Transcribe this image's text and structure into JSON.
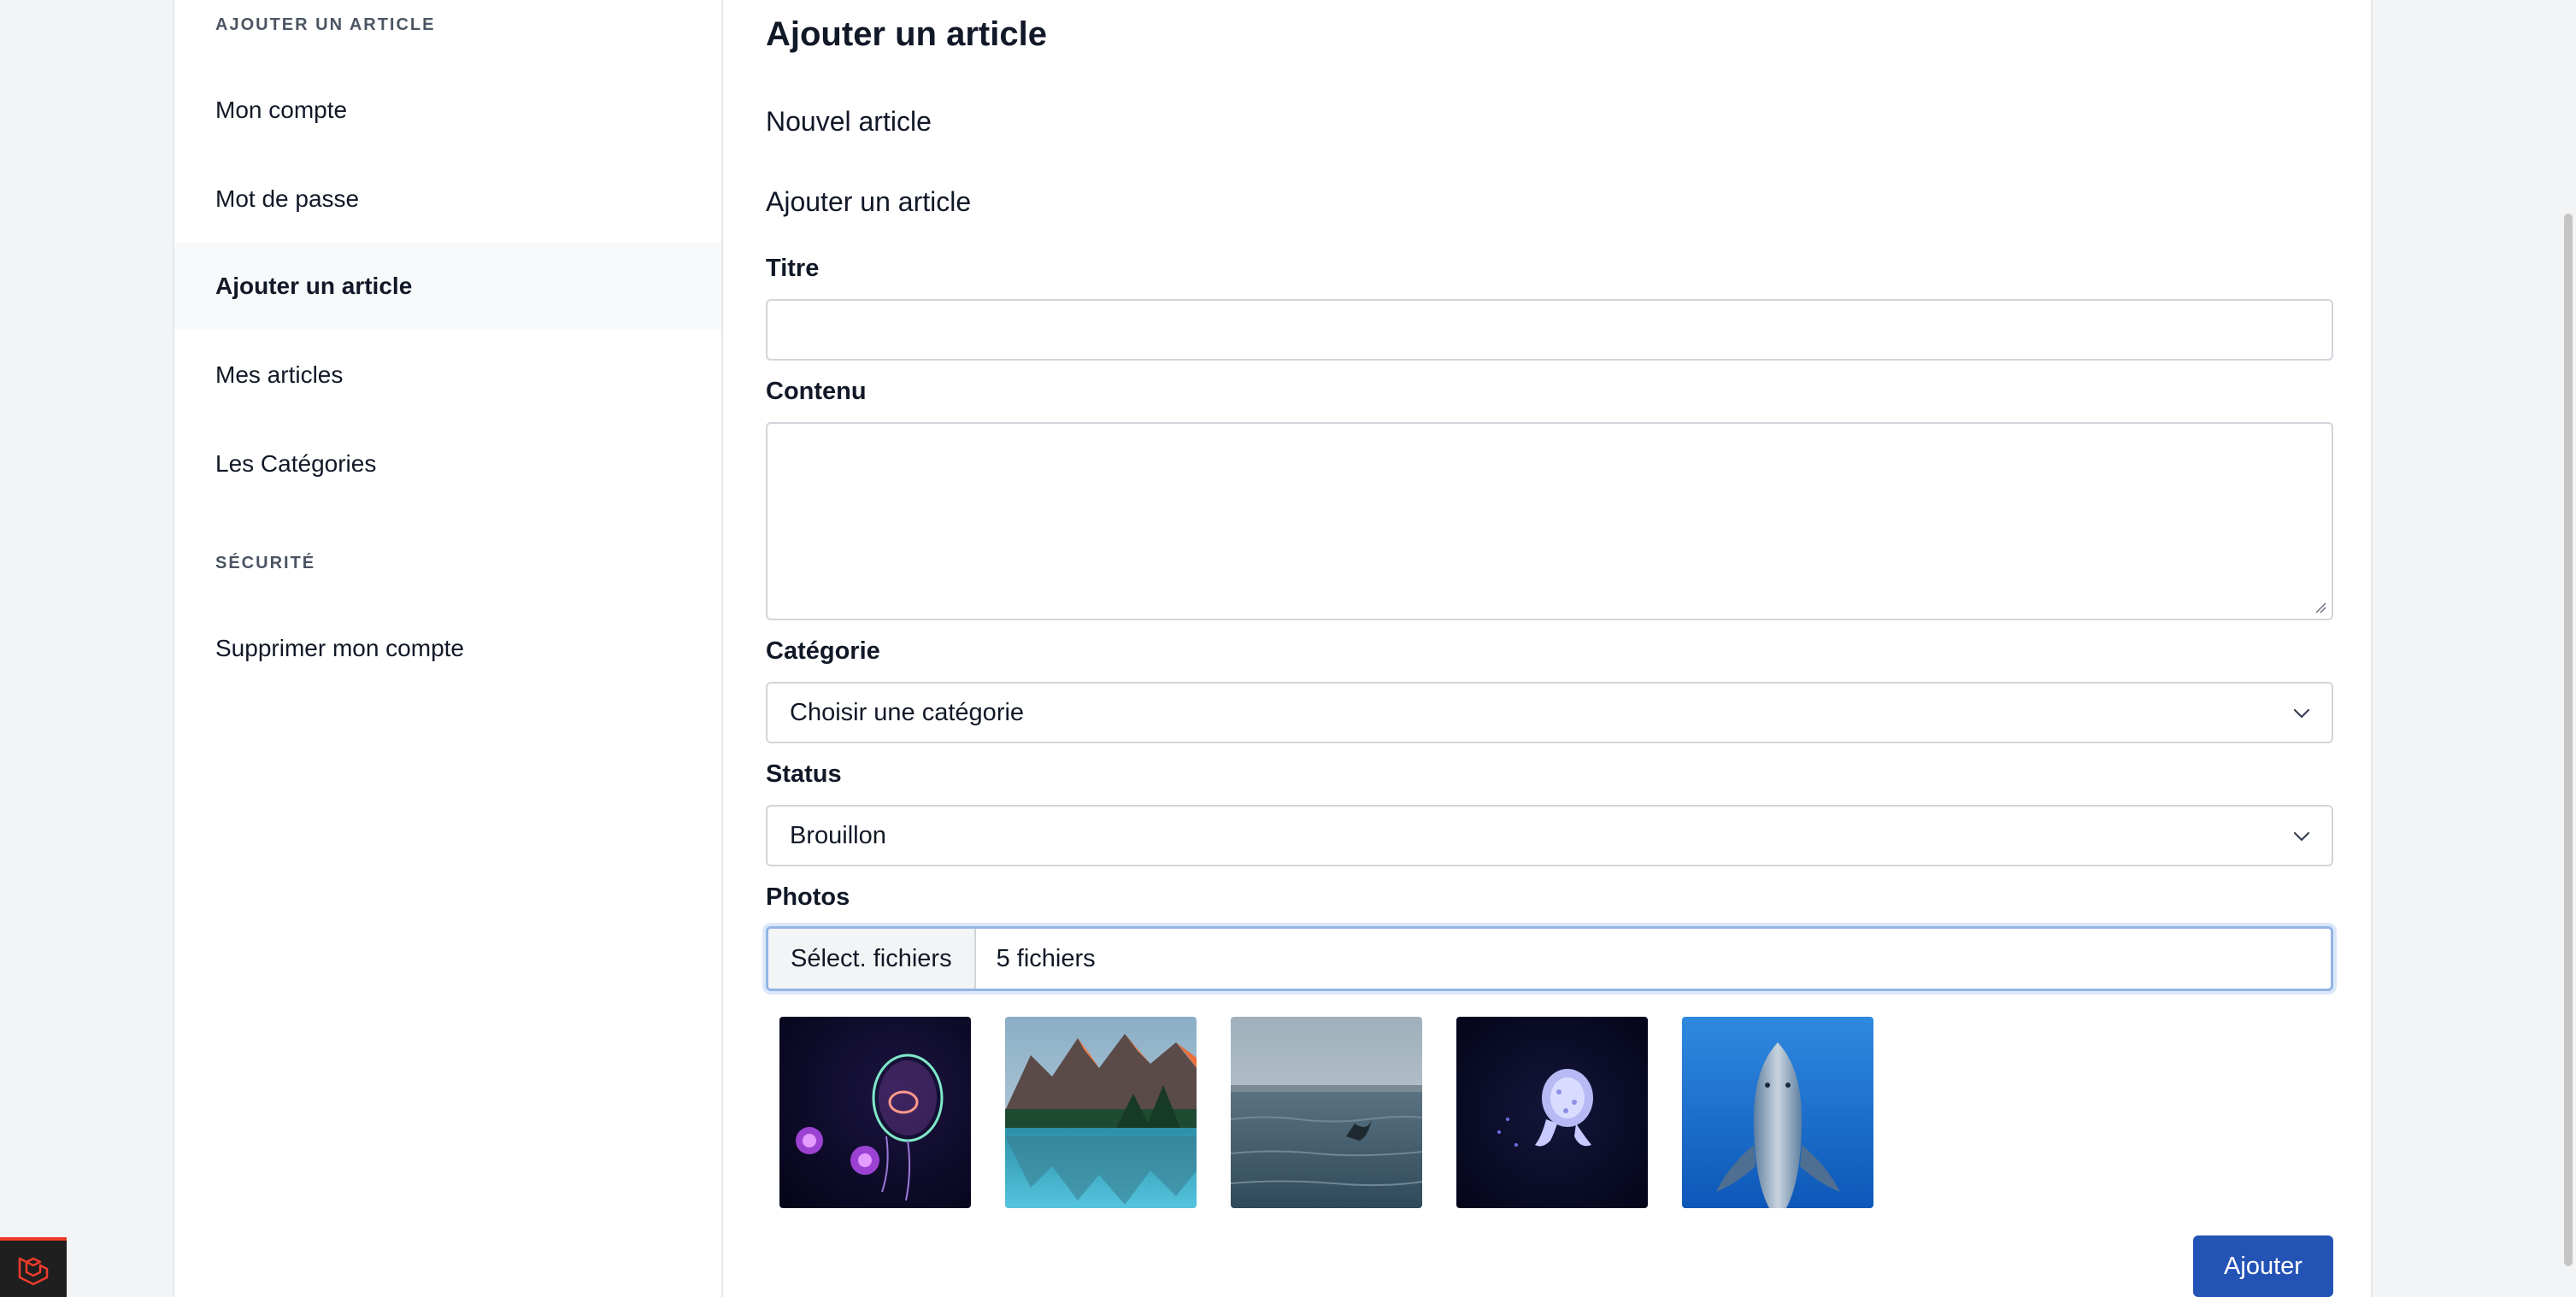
{
  "sidebar": {
    "section_article": "AJOUTER UN ARTICLE",
    "section_security": "SÉCURITÉ",
    "items": [
      {
        "label": "Mon compte"
      },
      {
        "label": "Mot de passe"
      },
      {
        "label": "Ajouter un article"
      },
      {
        "label": "Mes articles"
      },
      {
        "label": "Les Catégories"
      }
    ],
    "security_items": [
      {
        "label": "Supprimer mon compte"
      }
    ]
  },
  "main": {
    "page_title": "Ajouter un article",
    "card_header": "Nouvel article",
    "form_title": "Ajouter un article",
    "fields": {
      "titre_label": "Titre",
      "titre_value": "",
      "contenu_label": "Contenu",
      "contenu_value": "",
      "categorie_label": "Catégorie",
      "categorie_value": "Choisir une catégorie",
      "status_label": "Status",
      "status_value": "Brouillon",
      "photos_label": "Photos",
      "photos_button": "Sélect. fichiers",
      "photos_count": "5 fichiers"
    },
    "thumbnails": [
      {
        "name": "jellyfish-pink"
      },
      {
        "name": "mountain-lake"
      },
      {
        "name": "whale-tail-ocean"
      },
      {
        "name": "jellyfish-white"
      },
      {
        "name": "dolphin"
      }
    ],
    "submit_label": "Ajouter"
  },
  "colors": {
    "accent": "#2453b6",
    "focus_ring": "#93b4e6",
    "laravel_red": "#ef3b2d"
  }
}
